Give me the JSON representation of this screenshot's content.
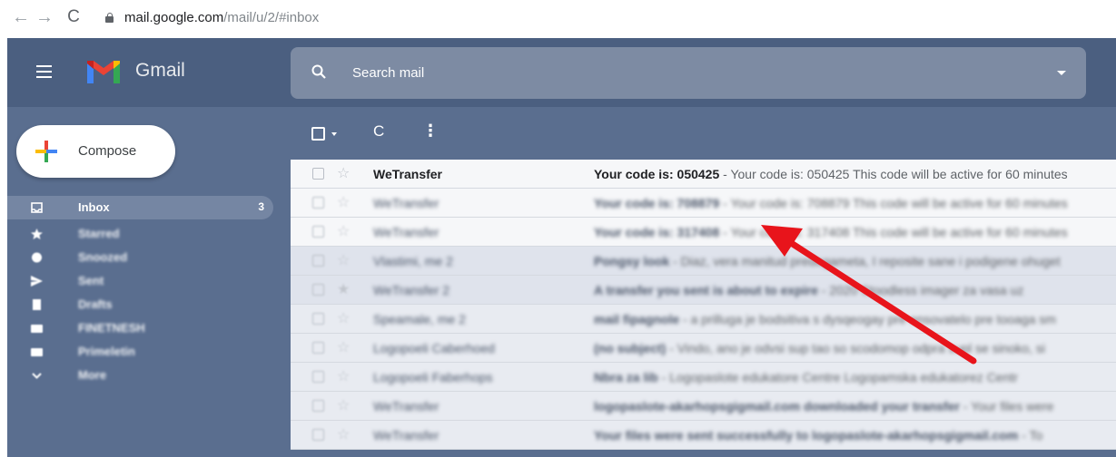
{
  "browser": {
    "back_icon": "←",
    "forward_icon": "→",
    "reload_icon": "C",
    "url_host": "mail.google.com",
    "url_path": "/mail/u/2/#inbox"
  },
  "app": {
    "brand": "Gmail",
    "search_placeholder": "Search mail",
    "compose_label": "Compose"
  },
  "sidebar": {
    "items": [
      {
        "label": "Inbox",
        "count": "3",
        "icon": "inbox-icon"
      },
      {
        "label": "Starred",
        "count": "",
        "icon": "star-icon"
      },
      {
        "label": "Snoozed",
        "count": "",
        "icon": "clock-icon"
      },
      {
        "label": "Sent",
        "count": "",
        "icon": "send-icon"
      },
      {
        "label": "Drafts",
        "count": "",
        "icon": "draft-icon"
      },
      {
        "label": "FINETNESH",
        "count": "",
        "icon": "label-icon"
      },
      {
        "label": "Primeletin",
        "count": "",
        "icon": "label-icon"
      },
      {
        "label": "More",
        "count": "",
        "icon": "chevron-down-icon"
      }
    ]
  },
  "toolbar": {
    "refresh_icon": "C",
    "more_icon": "⋮"
  },
  "emails": [
    {
      "sender": "WeTransfer",
      "subject": "Your code is: 050425",
      "snippet": " - Your code is: 050425 This code will be active for 60 minutes"
    },
    {
      "sender": "WeTransfer",
      "subject": "Your code is: 708879",
      "snippet": " - Your code is: 708879 This code will be active for 60 minutes"
    },
    {
      "sender": "WeTransfer",
      "subject": "Your code is: 317408",
      "snippet": " - Your code is: 317408 This code will be active for 60 minutes"
    },
    {
      "sender": "Vlastimi, me 2",
      "subject": "Pongsy look",
      "snippet": " - Diaz, vera manitud predagameta, I reposite sane i podigene ohuget"
    },
    {
      "sender": "WeTransfer 2",
      "subject": "A transfer you sent is about to expire",
      "snippet": " - 2020 Stoodless imager za vasa uz"
    },
    {
      "sender": "Speamale, me 2",
      "subject": "mail fipagnole",
      "snippet": " - a prilluga je bodsitiva s dysqeogay pre ensovatelo pre tooaga sm"
    },
    {
      "sender": "Logopoeli Caberhoed",
      "subject": "(no subject)",
      "snippet": " - Vindo, ano je odvsi sup tao so scodomop odpra supl se sinoko, si"
    },
    {
      "sender": "Logopoeli Faberhops",
      "subject": "Nbra za lib",
      "snippet": " - Logopaslote edukatore Centre Logopamska edukatorez Centr"
    },
    {
      "sender": "WeTransfer",
      "subject": "logopaslote-akarhopsgigmail.com downloaded your transfer",
      "snippet": " - Your files were"
    },
    {
      "sender": "WeTransfer",
      "subject": "Your files were sent successfully to logopaslote-akarhopsgigmail.com",
      "snippet": " - To"
    }
  ],
  "colors": {
    "topbar": "#4b5f80",
    "sidebar": "#5a6e8f",
    "search": "#7d8ba3",
    "annotation_arrow": "#e8141b"
  }
}
